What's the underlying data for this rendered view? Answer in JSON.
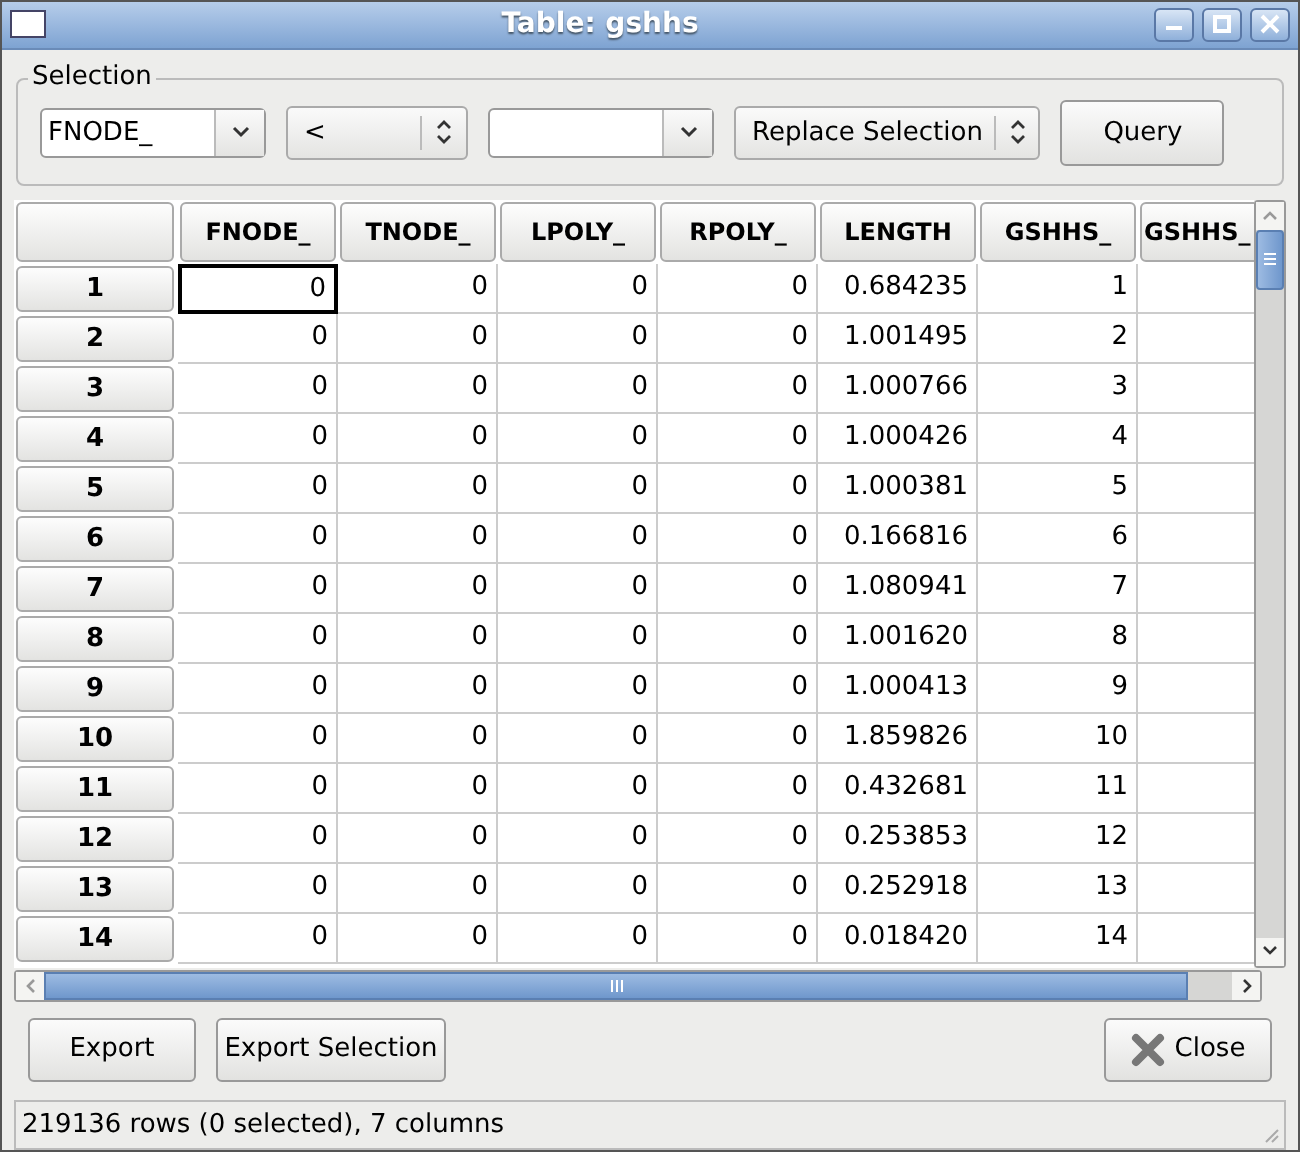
{
  "window": {
    "title": "Table: gshhs"
  },
  "selection": {
    "title": "Selection",
    "field": "FNODE_",
    "operator": "<",
    "mode": "Replace Selection",
    "query_button": "Query"
  },
  "table": {
    "columns": [
      "FNODE_",
      "TNODE_",
      "LPOLY_",
      "RPOLY_",
      "LENGTH",
      "GSHHS_",
      "GSHHS_"
    ],
    "rows": [
      {
        "header": "1",
        "focused": true,
        "cells": [
          "0",
          "0",
          "0",
          "0",
          "0.684235",
          "1"
        ]
      },
      {
        "header": "2",
        "focused": false,
        "cells": [
          "0",
          "0",
          "0",
          "0",
          "1.001495",
          "2"
        ]
      },
      {
        "header": "3",
        "focused": false,
        "cells": [
          "0",
          "0",
          "0",
          "0",
          "1.000766",
          "3"
        ]
      },
      {
        "header": "4",
        "focused": false,
        "cells": [
          "0",
          "0",
          "0",
          "0",
          "1.000426",
          "4"
        ]
      },
      {
        "header": "5",
        "focused": false,
        "cells": [
          "0",
          "0",
          "0",
          "0",
          "1.000381",
          "5"
        ]
      },
      {
        "header": "6",
        "focused": false,
        "cells": [
          "0",
          "0",
          "0",
          "0",
          "0.166816",
          "6"
        ]
      },
      {
        "header": "7",
        "focused": false,
        "cells": [
          "0",
          "0",
          "0",
          "0",
          "1.080941",
          "7"
        ]
      },
      {
        "header": "8",
        "focused": false,
        "cells": [
          "0",
          "0",
          "0",
          "0",
          "1.001620",
          "8"
        ]
      },
      {
        "header": "9",
        "focused": false,
        "cells": [
          "0",
          "0",
          "0",
          "0",
          "1.000413",
          "9"
        ]
      },
      {
        "header": "10",
        "focused": false,
        "cells": [
          "0",
          "0",
          "0",
          "0",
          "1.859826",
          "10"
        ]
      },
      {
        "header": "11",
        "focused": false,
        "cells": [
          "0",
          "0",
          "0",
          "0",
          "0.432681",
          "11"
        ]
      },
      {
        "header": "12",
        "focused": false,
        "cells": [
          "0",
          "0",
          "0",
          "0",
          "0.253853",
          "12"
        ]
      },
      {
        "header": "13",
        "focused": false,
        "cells": [
          "0",
          "0",
          "0",
          "0",
          "0.252918",
          "13"
        ]
      },
      {
        "header": "14",
        "focused": false,
        "cells": [
          "0",
          "0",
          "0",
          "0",
          "0.018420",
          "14"
        ]
      }
    ]
  },
  "buttons": {
    "export": "Export",
    "export_selection": "Export Selection",
    "close": "Close"
  },
  "status_bar": "219136 rows (0 selected), 7 columns"
}
